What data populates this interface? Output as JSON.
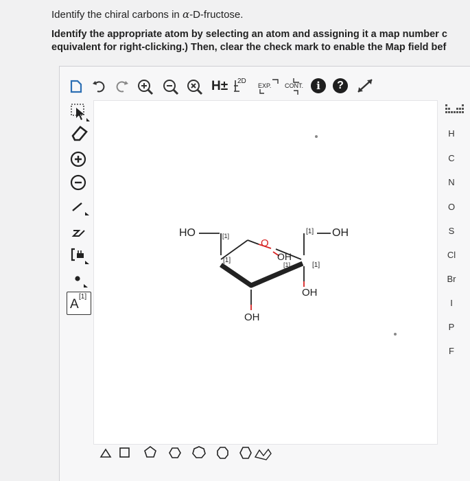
{
  "question": {
    "title_prefix": "Identify the chiral carbons in ",
    "title_alpha": "α",
    "title_suffix": "-D-fructose.",
    "instruction_line1": "Identify the appropriate atom by selecting an atom and assigning it a map number c",
    "instruction_line2": "equivalent for right-clicking.) Then, clear the check mark to enable the Map field bef"
  },
  "toolbar": {
    "h_label": "H±",
    "twod_label": "2D",
    "exp_label": "EXP.",
    "cont_label": "CONT.",
    "info_label": "i",
    "help_label": "?"
  },
  "left_tools": {
    "map_letter": "A",
    "map_number": "[1]"
  },
  "elements": [
    "H",
    "C",
    "N",
    "O",
    "S",
    "Cl",
    "Br",
    "I",
    "P",
    "F"
  ],
  "molecule": {
    "ho_left": "HO",
    "map_c6": "[1]",
    "ring_o": "O",
    "map_c2": "[1]",
    "oh_c2": "OH",
    "map_c1": "[1]",
    "oh_c3": "OH",
    "map_c4": "[1]",
    "map_c5": "[1]",
    "oh_c4": "OH",
    "oh_c5": "OH"
  }
}
